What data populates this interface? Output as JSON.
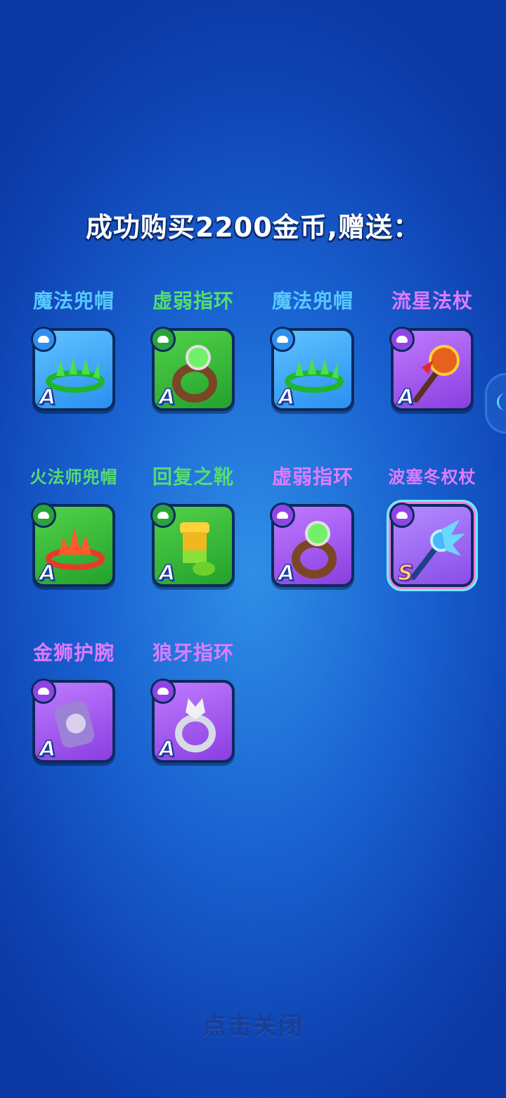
{
  "title": "成功购买2200金币,赠送：",
  "close_label": "点击关闭",
  "items": [
    {
      "name": "魔法兜帽",
      "name_color": "#58c8ff",
      "rarity": "blue",
      "grade": "A",
      "badge_icon": "hat-icon",
      "art": "leaf-crown"
    },
    {
      "name": "虚弱指环",
      "name_color": "#56dc6e",
      "rarity": "green",
      "grade": "A",
      "badge_icon": "ring-icon",
      "art": "gem-ring"
    },
    {
      "name": "魔法兜帽",
      "name_color": "#58c8ff",
      "rarity": "blue",
      "grade": "A",
      "badge_icon": "hat-icon",
      "art": "leaf-crown"
    },
    {
      "name": "流星法杖",
      "name_color": "#e07bff",
      "rarity": "purple",
      "grade": "A",
      "badge_icon": "staff-icon",
      "art": "meteor-staff"
    },
    {
      "name": "火法师兜帽",
      "name_color": "#56dc6e",
      "rarity": "green",
      "grade": "A",
      "badge_icon": "hat-icon",
      "art": "fire-crown"
    },
    {
      "name": "回复之靴",
      "name_color": "#56dc6e",
      "rarity": "green",
      "grade": "A",
      "badge_icon": "boot-icon",
      "art": "boot"
    },
    {
      "name": "虚弱指环",
      "name_color": "#e07bff",
      "rarity": "purple",
      "grade": "A",
      "badge_icon": "ring-icon",
      "art": "gem-ring"
    },
    {
      "name": "波塞冬权杖",
      "name_color": "#e07bff",
      "rarity": "rainbow",
      "grade": "S",
      "badge_icon": "staff-icon",
      "art": "ice-scepter"
    },
    {
      "name": "金狮护腕",
      "name_color": "#e07bff",
      "rarity": "purple",
      "grade": "A",
      "badge_icon": "bracer-icon",
      "art": "lion-bracer"
    },
    {
      "name": "狼牙指环",
      "name_color": "#e07bff",
      "rarity": "purple",
      "grade": "A",
      "badge_icon": "ring-icon",
      "art": "wolf-ring"
    }
  ]
}
